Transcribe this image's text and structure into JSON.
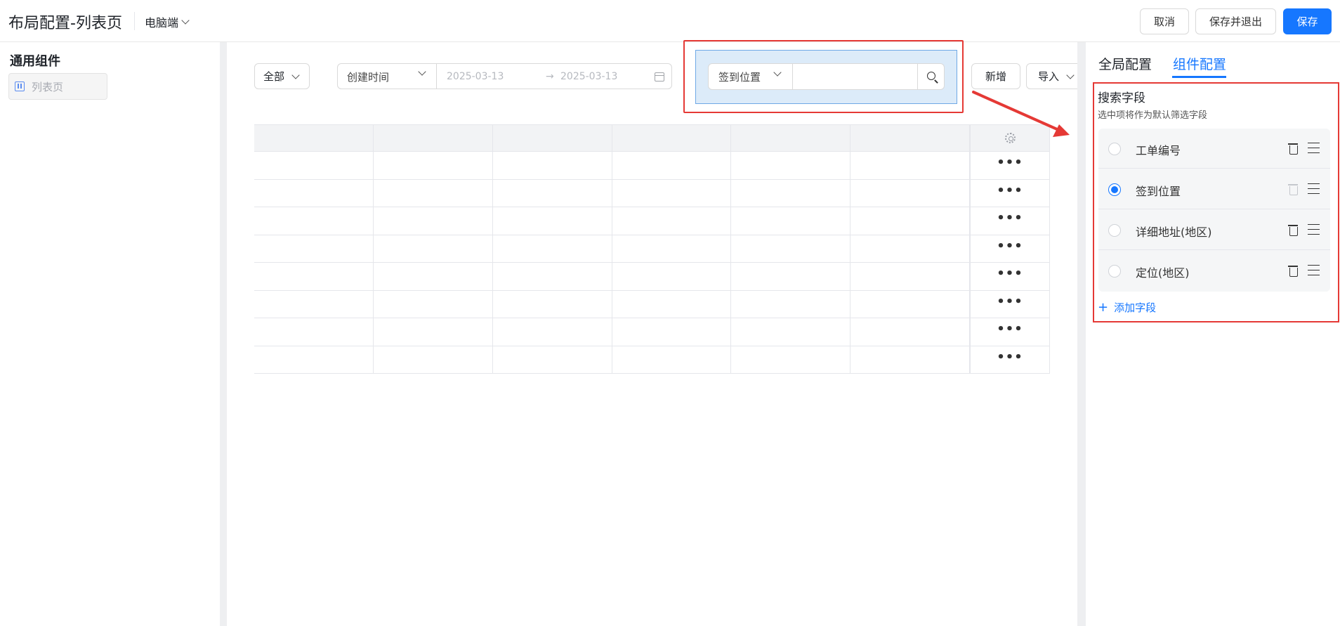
{
  "header": {
    "title": "布局配置-列表页",
    "device": "电脑端",
    "cancel_label": "取消",
    "save_exit_label": "保存并退出",
    "save_label": "保存"
  },
  "left_panel": {
    "title": "通用组件",
    "component_label": "列表页"
  },
  "canvas": {
    "filter_all": "全部",
    "date_field": "创建时间",
    "date_start": "2025-03-13",
    "date_sep": "→",
    "date_end": "2025-03-13",
    "search_field": "签到位置",
    "search_value": "",
    "add_label": "新增",
    "import_label": "导入",
    "table_rows": 8,
    "row_action": "•••"
  },
  "right_panel": {
    "tabs": [
      {
        "label": "全局配置",
        "active": false
      },
      {
        "label": "组件配置",
        "active": true
      }
    ],
    "section_title": "搜索字段",
    "section_hint": "选中项将作为默认筛选字段",
    "fields": [
      {
        "label": "工单编号",
        "selected": false,
        "deletable": true
      },
      {
        "label": "签到位置",
        "selected": true,
        "deletable": false
      },
      {
        "label": "详细地址(地区)",
        "selected": false,
        "deletable": true
      },
      {
        "label": "定位(地区)",
        "selected": false,
        "deletable": true
      }
    ],
    "add_field_label": "添加字段"
  },
  "colors": {
    "primary": "#1677ff",
    "annotation_red": "#e53935",
    "highlight_fill": "#dcebf9"
  }
}
